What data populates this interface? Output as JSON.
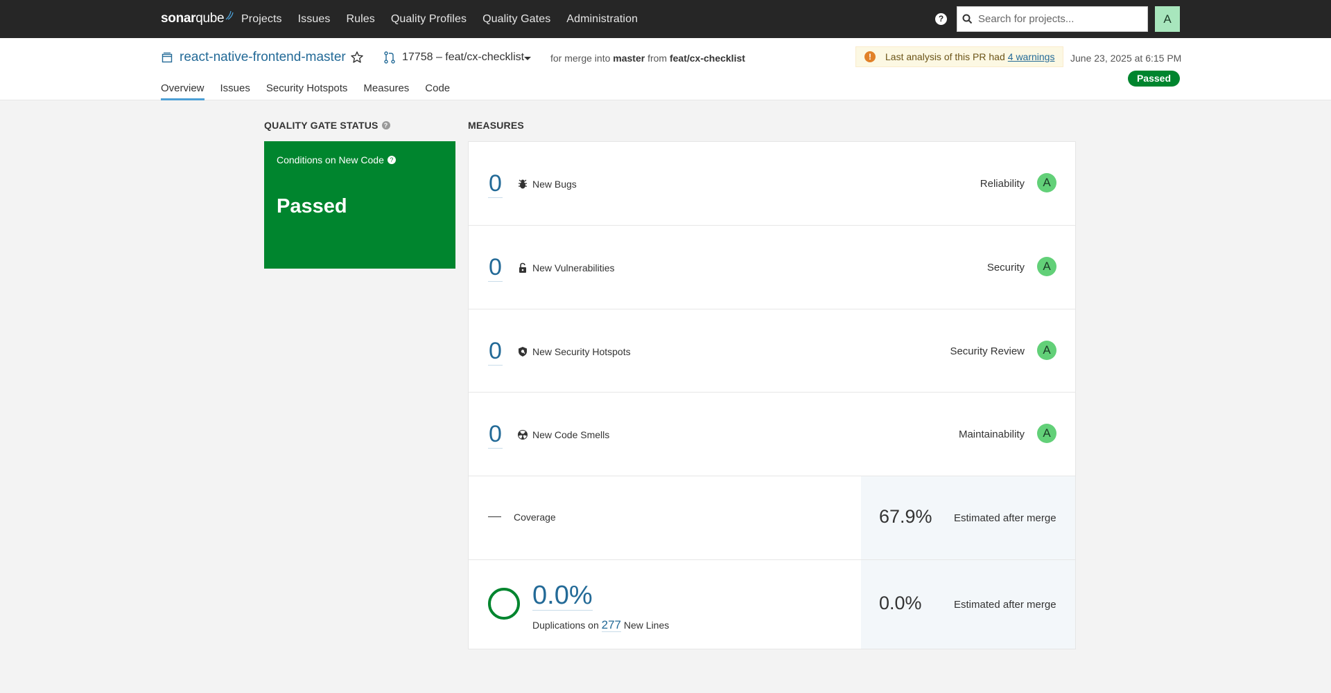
{
  "topnav": {
    "logo": {
      "sonar": "sonar",
      "qube": "qube"
    },
    "links": [
      "Projects",
      "Issues",
      "Rules",
      "Quality Profiles",
      "Quality Gates",
      "Administration"
    ],
    "help_label": "?",
    "search_placeholder": "Search for projects...",
    "avatar": "A"
  },
  "project": {
    "name": "react-native-frontend-master",
    "branch": "17758 – feat/cx-checklist",
    "merge_prefix": "for merge into",
    "merge_target": "master",
    "merge_from": "from",
    "merge_source": "feat/cx-checklist",
    "warning_text": "Last analysis of this PR had",
    "warning_link": "4 warnings",
    "date": "June 23, 2025 at 6:15 PM",
    "status": "Passed",
    "tabs": [
      "Overview",
      "Issues",
      "Security Hotspots",
      "Measures",
      "Code"
    ]
  },
  "quality_gate": {
    "heading": "QUALITY GATE STATUS",
    "conditions_label": "Conditions on New Code",
    "status": "Passed",
    "color": "#00852e"
  },
  "measures": {
    "heading": "MEASURES",
    "rows": [
      {
        "value": "0",
        "icon": "bug-icon",
        "label": "New Bugs",
        "category": "Reliability",
        "rating": "A"
      },
      {
        "value": "0",
        "icon": "lock-icon",
        "label": "New Vulnerabilities",
        "category": "Security",
        "rating": "A"
      },
      {
        "value": "0",
        "icon": "shield-icon",
        "label": "New Security Hotspots",
        "category": "Security Review",
        "rating": "A"
      },
      {
        "value": "0",
        "icon": "code-smell-icon",
        "label": "New Code Smells",
        "category": "Maintainability",
        "rating": "A"
      }
    ],
    "coverage": {
      "value": "—",
      "label": "Coverage",
      "estimated": "67.9%",
      "estimated_label": "Estimated after merge"
    },
    "duplications": {
      "value": "0.0%",
      "label_prefix": "Duplications on",
      "lines": "277",
      "label_suffix": "New Lines",
      "estimated": "0.0%",
      "estimated_label": "Estimated after merge"
    },
    "rating_color": "#62d078"
  }
}
